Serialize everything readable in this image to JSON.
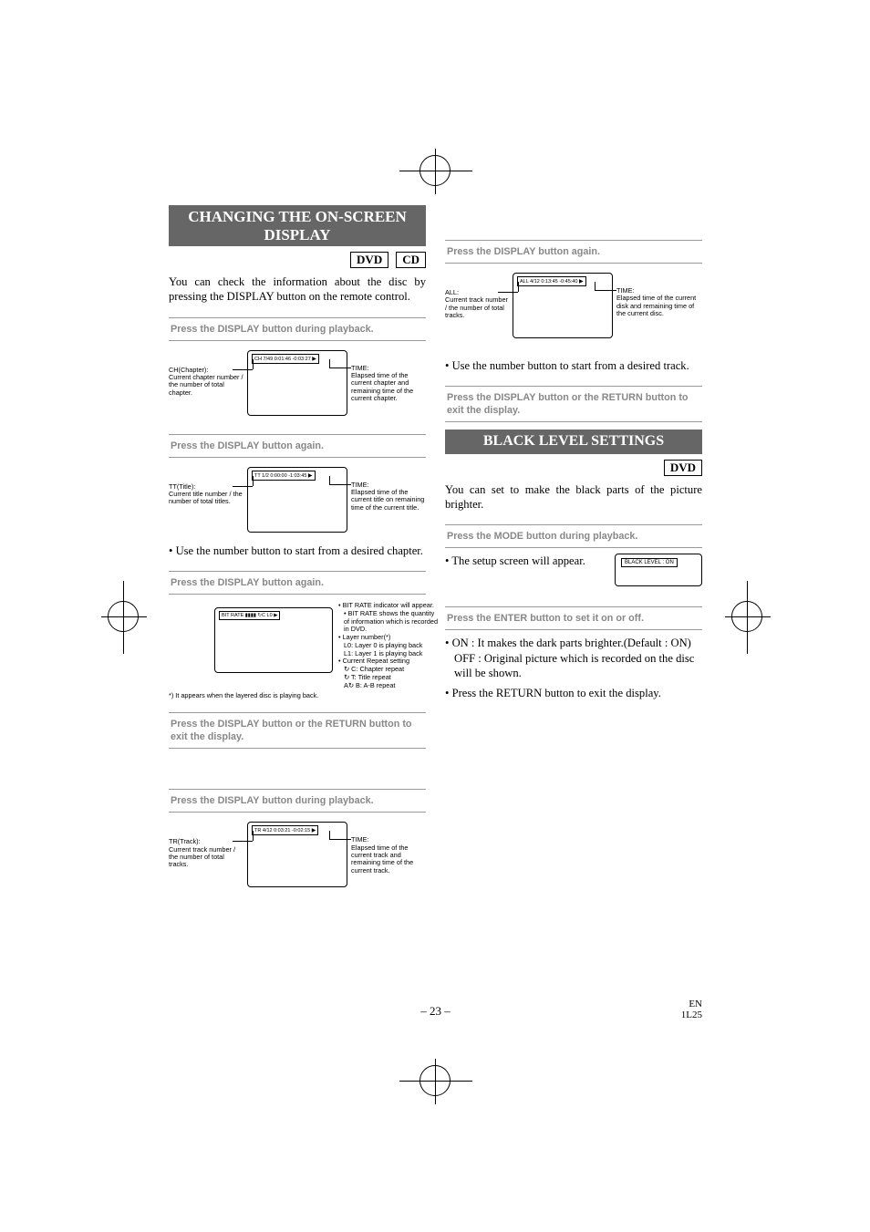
{
  "section1": {
    "title": "CHANGING THE ON-SCREEN DISPLAY",
    "discs": [
      "DVD",
      "CD"
    ],
    "intro": "You can check the information about the disc by pressing the DISPLAY button on the remote control.",
    "step1": "Press the DISPLAY button during playback.",
    "diag1": {
      "lcd": "CH   7/49   0:01:46  -0:03:27",
      "left_label": "CH(Chapter):",
      "left_text": "Current chapter number / the number of total chapter.",
      "right_label": "TIME:",
      "right_text": "Elapsed time of the current chapter and remaining time of the current chapter."
    },
    "step2": "Press the DISPLAY button again.",
    "diag2": {
      "lcd": "TT    1/2    0:00:00 -1:03:45",
      "left_label": "TT(Title):",
      "left_text": "Current title number / the number of total titles.",
      "right_label": "TIME:",
      "right_text": "Elapsed time of the current title on remaining time of the current title."
    },
    "step2_bullet": "Use the number button to start from a desired chapter.",
    "step3": "Press the DISPLAY button again.",
    "bitrate": {
      "lcd_label": "BIT RATE",
      "lcd_bars": "▮▮▮▮",
      "lcd_repeat": "↻C",
      "lcd_layer": "L0",
      "note1": "• BIT RATE indicator will appear.",
      "note2": "• BIT RATE shows the quantity of information which is recorded in DVD.",
      "note3": "• Layer number(*)",
      "note3a": "  L0: Layer 0 is playing back",
      "note3b": "  L1: Layer 1 is playing back",
      "note4": "• Current Repeat setting",
      "note4a": "  ↻ C: Chapter repeat",
      "note4b": "  ↻ T: Title repeat",
      "note4c": "  A↻ B: A-B repeat",
      "footnote": "*) It appears when the layered disc is playing back."
    },
    "step4": "Press the DISPLAY button or the RETURN button to exit the display.",
    "cd_step1": "Press the DISPLAY button during playback.",
    "cd_diag1": {
      "lcd": "TR   4/12   0:03:21 -0:02:15",
      "left_label": "TR(Track):",
      "left_text": "Current track number / the number of total tracks.",
      "right_label": "TIME:",
      "right_text": "Elapsed time of the current track and remaining time of the current track."
    },
    "cd_step2": "Press the DISPLAY button again.",
    "cd_diag2": {
      "lcd": "ALL   4/12   0:13:45 -0:45:40",
      "left_label": "ALL:",
      "left_text": "Current track number / the number of total tracks.",
      "right_label": "TIME:",
      "right_text": "Elapsed time of the current disk and remaining time of the current disc."
    },
    "cd_bullet": "Use the number button to start from a desired track.",
    "cd_step3": "Press the DISPLAY button or the RETURN button to exit the display."
  },
  "section2": {
    "title": "BLACK LEVEL SETTINGS",
    "discs": [
      "DVD"
    ],
    "intro": "You can set to make the black parts of the picture brighter.",
    "step1": "Press the MODE button during playback.",
    "setup_bullet": "The setup screen will appear.",
    "setup_lcd": "BLACK LEVEL : ON",
    "step2": "Press the ENTER button to set it on or off.",
    "bullet_on": "ON : It makes the dark parts brighter.(Default : ON)",
    "bullet_off": "OFF : Original picture which is recorded on the disc will be shown.",
    "bullet_return": "Press the RETURN button to exit the display."
  },
  "footer": {
    "page": "– 23 –",
    "code1": "EN",
    "code2": "1L25"
  }
}
